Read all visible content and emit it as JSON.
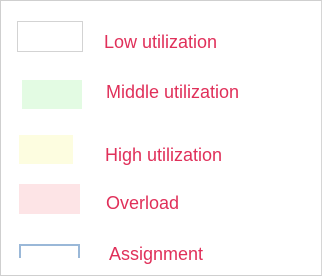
{
  "legend": {
    "items": [
      {
        "key": "low",
        "label": "Low utilization",
        "color": "#ffffff",
        "border": "#d3d3d3"
      },
      {
        "key": "middle",
        "label": "Middle utilization",
        "color": "#e3fbe3"
      },
      {
        "key": "high",
        "label": "High utilization",
        "color": "#fdfde0"
      },
      {
        "key": "overload",
        "label": "Overload",
        "color": "#fde4e6"
      },
      {
        "key": "assignment",
        "label": "Assignment",
        "color": "#9ab8d8"
      }
    ],
    "label_color": "#e0305a"
  }
}
